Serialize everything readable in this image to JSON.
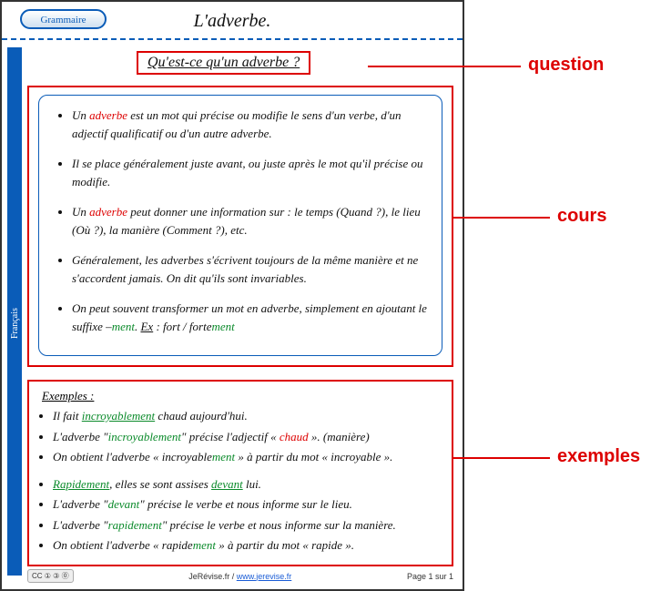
{
  "side_label": "Français",
  "tab_label": "Grammaire",
  "title": "L'adverbe.",
  "question": "Qu'est-ce qu'un adverbe ?",
  "cours": {
    "b1_a": "Un ",
    "b1_kw": "adverbe",
    "b1_b": " est un mot qui précise ou modifie le sens d'un verbe, d'un adjectif qualificatif ou d'un autre adverbe.",
    "b2": "Il se place généralement juste avant, ou juste après le mot qu'il précise ou modifie.",
    "b3_a": "Un ",
    "b3_kw": "adverbe",
    "b3_b": " peut donner une information sur : le temps (Quand ?), le lieu (Où ?), la manière (Comment ?), etc.",
    "b4": "Généralement, les adverbes s'écrivent toujours de la même manière et ne s'accordent jamais. On dit qu'ils sont invariables.",
    "b5_a": "On peut souvent transformer un mot en adverbe, simplement en ajoutant le suffixe –",
    "b5_kw": "ment",
    "b5_b": ".      ",
    "b5_ex_lbl": "Ex",
    "b5_ex": " : fort / ",
    "b5_ex2_a": "forte",
    "b5_ex2_b": "ment"
  },
  "exemples": {
    "title": "Exemples :",
    "g1_1_a": "Il fait ",
    "g1_1_kw": "incroyablement",
    "g1_1_b": " chaud aujourd'hui.",
    "g1_2_a": "L'adverbe \"",
    "g1_2_kw": "incroyablement",
    "g1_2_b": "\" précise l'adjectif « ",
    "g1_2_c": "chaud",
    "g1_2_d": " ». (manière)",
    "g1_3_a": "On obtient l'adverbe « incroyable",
    "g1_3_kw": "ment",
    "g1_3_b": " » à partir du mot «  incroyable ».",
    "g2_1_a": "Rapidement",
    "g2_1_b": ", elles se sont assises ",
    "g2_1_c": "devant",
    "g2_1_d": " lui.",
    "g2_2_a": "L'adverbe \"",
    "g2_2_kw": "devant",
    "g2_2_b": "\" précise le verbe et nous informe sur le lieu.",
    "g2_3_a": "L'adverbe \"",
    "g2_3_kw": "rapidement",
    "g2_3_b": "\" précise le verbe et nous informe sur la manière.",
    "g2_4_a": "On obtient l'adverbe « rapide",
    "g2_4_kw": "ment",
    "g2_4_b": " » à partir du mot « rapide »."
  },
  "footer": {
    "cc": "CC ① ③ ⓪",
    "site_text": "JeRévise.fr  / ",
    "site_link": "www.jerevise.fr",
    "page": "Page 1 sur 1"
  },
  "annotations": {
    "question": "question",
    "cours": "cours",
    "exemples": "exemples"
  }
}
